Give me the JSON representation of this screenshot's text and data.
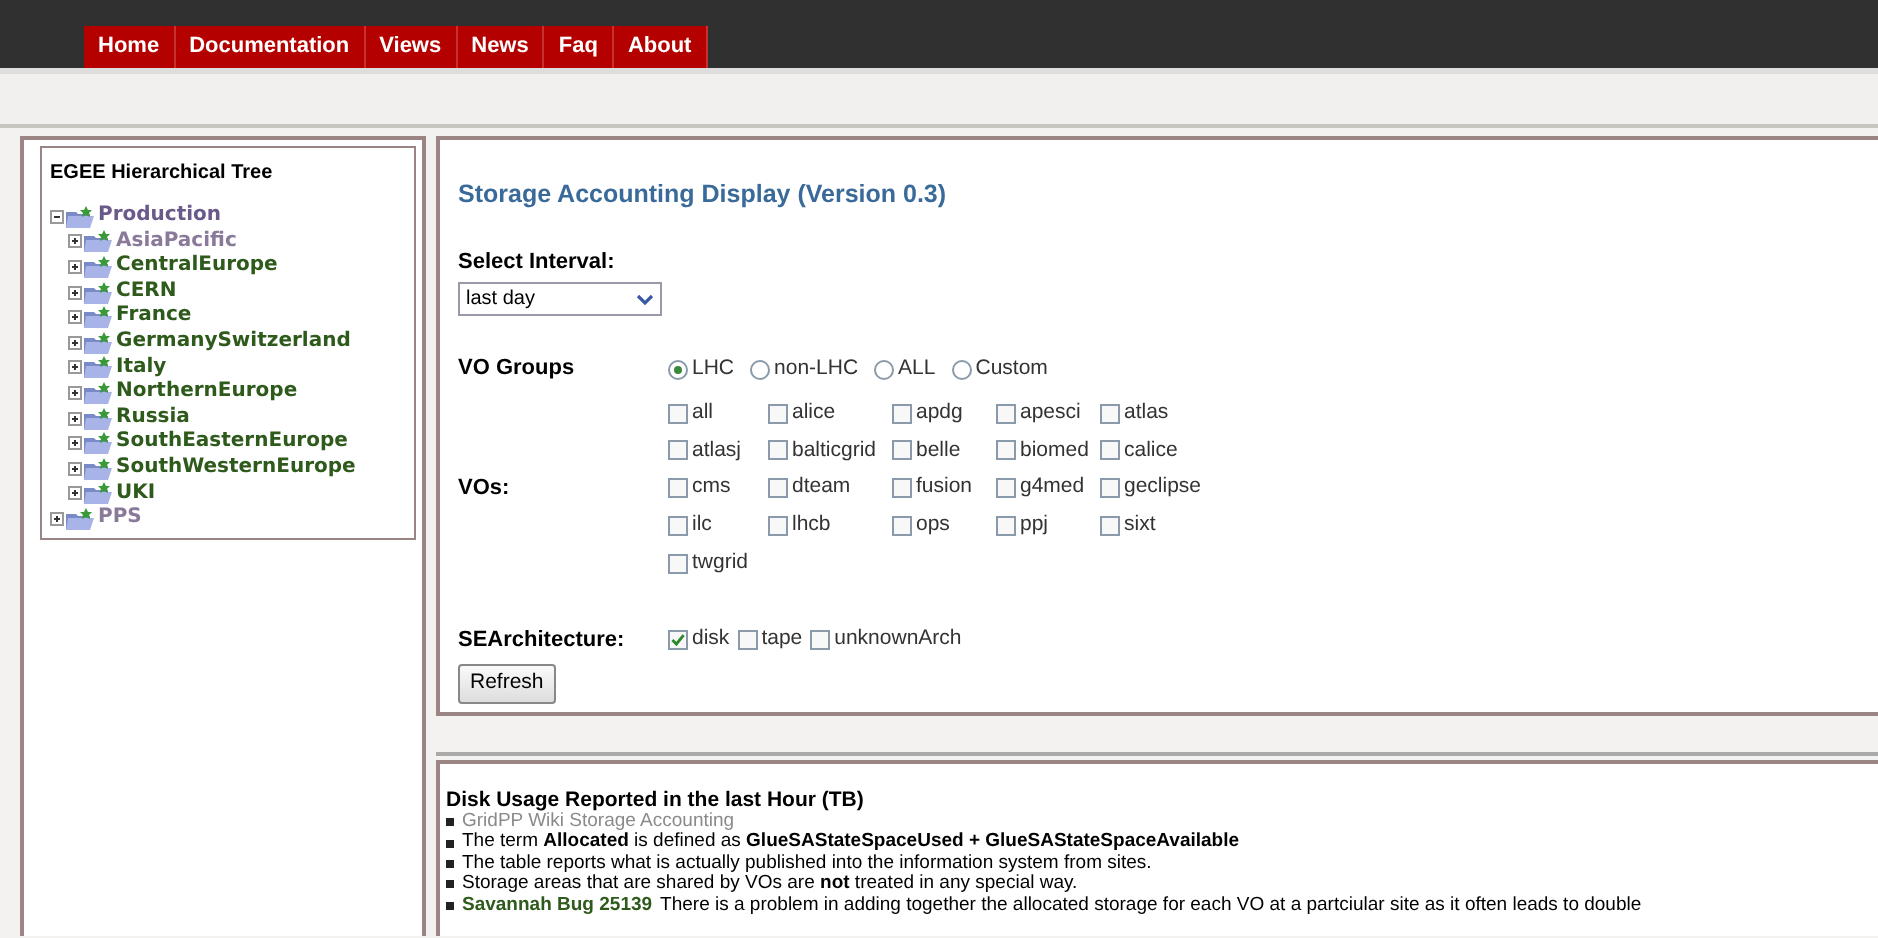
{
  "nav": [
    {
      "label": "Home"
    },
    {
      "label": "Documentation"
    },
    {
      "label": "Views"
    },
    {
      "label": "News"
    },
    {
      "label": "Faq"
    },
    {
      "label": "About"
    }
  ],
  "tree": {
    "title": "EGEE Hierarchical Tree",
    "items": [
      {
        "label": "Production",
        "expanded": true,
        "color": "#6a5a8a",
        "children": [
          {
            "label": "AsiaPacific",
            "expanded": false,
            "color": "#8a7a9a"
          },
          {
            "label": "CentralEurope",
            "expanded": false,
            "color": "#2e5a1c"
          },
          {
            "label": "CERN",
            "expanded": false,
            "color": "#2e5a1c"
          },
          {
            "label": "France",
            "expanded": false,
            "color": "#2e5a1c"
          },
          {
            "label": "GermanySwitzerland",
            "expanded": false,
            "color": "#2e5a1c"
          },
          {
            "label": "Italy",
            "expanded": false,
            "color": "#2e5a1c"
          },
          {
            "label": "NorthernEurope",
            "expanded": false,
            "color": "#2e5a1c"
          },
          {
            "label": "Russia",
            "expanded": false,
            "color": "#2e5a1c"
          },
          {
            "label": "SouthEasternEurope",
            "expanded": false,
            "color": "#2e5a1c"
          },
          {
            "label": "SouthWesternEurope",
            "expanded": false,
            "color": "#2e5a1c"
          },
          {
            "label": "UKI",
            "expanded": false,
            "color": "#2e5a1c"
          }
        ]
      },
      {
        "label": "PPS",
        "expanded": false,
        "color": "#8a7a9a"
      }
    ]
  },
  "form": {
    "title": "Storage Accounting Display (Version 0.3)",
    "interval_label": "Select Interval:",
    "interval": "last day",
    "vo_groups_label": "VO Groups",
    "vo_groups": [
      {
        "label": "LHC",
        "selected": true
      },
      {
        "label": "non-LHC",
        "selected": false
      },
      {
        "label": "ALL",
        "selected": false
      },
      {
        "label": "Custom",
        "selected": false
      }
    ],
    "vos_label": "VOs:",
    "vos": [
      {
        "label": "all",
        "checked": false
      },
      {
        "label": "alice",
        "checked": false
      },
      {
        "label": "apdg",
        "checked": false
      },
      {
        "label": "apesci",
        "checked": false
      },
      {
        "label": "atlas",
        "checked": false
      },
      {
        "label": "atlasj",
        "checked": false
      },
      {
        "label": "balticgrid",
        "checked": false
      },
      {
        "label": "belle",
        "checked": false
      },
      {
        "label": "biomed",
        "checked": false
      },
      {
        "label": "calice",
        "checked": false
      },
      {
        "label": "cms",
        "checked": false
      },
      {
        "label": "dteam",
        "checked": false
      },
      {
        "label": "fusion",
        "checked": false
      },
      {
        "label": "g4med",
        "checked": false
      },
      {
        "label": "geclipse",
        "checked": false
      },
      {
        "label": "ilc",
        "checked": false
      },
      {
        "label": "lhcb",
        "checked": false
      },
      {
        "label": "ops",
        "checked": false
      },
      {
        "label": "ppj",
        "checked": false
      },
      {
        "label": "sixt",
        "checked": false
      },
      {
        "label": "twgrid",
        "checked": false
      }
    ],
    "arch_label": "SEArchitecture:",
    "arch": [
      {
        "label": "disk",
        "checked": true
      },
      {
        "label": "tape",
        "checked": false
      },
      {
        "label": "unknownArch",
        "checked": false
      }
    ],
    "refresh": "Refresh"
  },
  "notes": {
    "title": "Disk Usage Reported in the last Hour (TB)",
    "items": [
      {
        "link": "GridPP Wiki Storage Accounting",
        "color": "#8a8a8a"
      },
      {
        "text": "The term **Allocated** is defined as **GlueSAStateSpaceUsed + GlueSAStateSpaceAvailable**"
      },
      {
        "text": "The table reports what is actually published into the information system from sites."
      },
      {
        "text": "Storage areas that are shared by VOs are **not** treated in any special way."
      },
      {
        "link": "Savannah Bug 25139",
        "color": "#2e5a1c",
        "text": "There is a problem in adding together the allocated storage for each VO at a partciular site as it often leads to double"
      }
    ]
  }
}
